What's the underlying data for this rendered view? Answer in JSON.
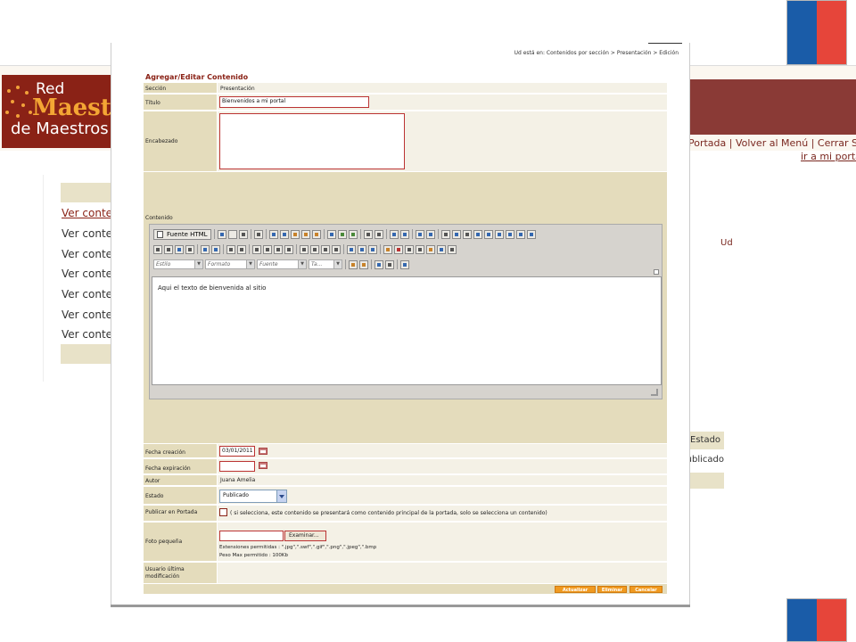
{
  "background_page": {
    "logo": {
      "line1": "Red",
      "line2": "Maestros",
      "line3": "de Maestros"
    },
    "nav_text": "Portada | Volver al Menú | Cerrar Sesión",
    "ir_portal": "ir a mi portal",
    "ud": "Ud",
    "left_links": [
      "Ver contenido",
      "Ver contenido",
      "Ver contenido",
      "Ver contenido",
      "Ver contenido",
      "Ver contenido",
      "Ver contenido"
    ],
    "right_table": {
      "header": "Estado",
      "cell": "Publicado"
    }
  },
  "dialog": {
    "breadcrumb": "Ud está en: Contenidos por sección > Presentación > Edición",
    "title": "Agregar/Editar Contenido",
    "fields": {
      "seccion": {
        "label": "Sección",
        "value": "Presentación"
      },
      "titulo": {
        "label": "Título",
        "value": "Bienvenidos a mi portal"
      },
      "encabezado": {
        "label": "Encabezado",
        "value": ""
      },
      "contenido": {
        "label": "Contenido"
      },
      "fecha_creacion": {
        "label": "Fecha creación",
        "value": "03/01/2011"
      },
      "fecha_expiracion": {
        "label": "Fecha expiración",
        "value": ""
      },
      "autor": {
        "label": "Autor",
        "value": "Juana Amelia"
      },
      "estado": {
        "label": "Estado",
        "value": "Publicado"
      },
      "publicar_portada": {
        "label": "Publicar en Portada",
        "note": "( si selecciona, este contenido se presentará como contenido principal de la portada, solo se selecciona un contenido)",
        "checked": false
      },
      "foto_pequena": {
        "label": "Foto pequeña",
        "browse_button": "Examinar...",
        "extensions": "Extensiones permitidas : \".jpg\",\".swf\",\".gif\",\".png\",\".jpeg\",\".bmp",
        "max_weight": "Peso Max permitido : 100Kb"
      },
      "usuario_modificacion": {
        "label": "Usuario última modificación",
        "value": ""
      }
    },
    "editor": {
      "source_button": "Fuente HTML",
      "style_select": "Estilo",
      "format_select": "Formato",
      "font_select": "Fuente",
      "size_select": "Ta...",
      "content_text": "Aqui el texto de bienvenida al sitio"
    },
    "buttons": {
      "update": "Actualizar",
      "delete": "Eliminar",
      "cancel": "Cancelar"
    }
  }
}
